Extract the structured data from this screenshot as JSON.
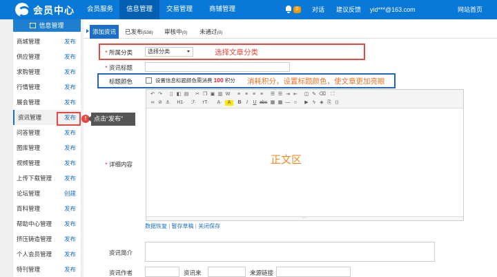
{
  "header": {
    "logo_text": "会员中心",
    "nav": [
      "会员服务",
      "信息管理",
      "交易管理",
      "商铺管理"
    ],
    "notify_count": "0",
    "links": [
      "对话",
      "建议反馈"
    ],
    "user": "yid***@163.com",
    "home_link": "网站首页"
  },
  "sidebar": {
    "title": "信息管理",
    "items": [
      {
        "label": "商城管理",
        "action": "发布"
      },
      {
        "label": "供应管理",
        "action": "发布"
      },
      {
        "label": "求购管理",
        "action": "发布"
      },
      {
        "label": "行情管理",
        "action": "发布"
      },
      {
        "label": "展会管理",
        "action": "发布"
      },
      {
        "label": "资讯管理",
        "action": "发布"
      },
      {
        "label": "问答管理",
        "action": "发布"
      },
      {
        "label": "图库管理",
        "action": "发布"
      },
      {
        "label": "视频管理",
        "action": "发布"
      },
      {
        "label": "上传下载管理",
        "action": "发布"
      },
      {
        "label": "论坛管理",
        "action": "创建"
      },
      {
        "label": "百科管理",
        "action": "发布"
      },
      {
        "label": "帮助中心管理",
        "action": "发布"
      },
      {
        "label": "挤压铸造管理",
        "action": "发布"
      },
      {
        "label": "个人会员管理",
        "action": "发布"
      },
      {
        "label": "特刊管理",
        "action": "发布"
      }
    ]
  },
  "tabs": [
    {
      "label": "添加资讯",
      "count": ""
    },
    {
      "label": "已发布",
      "count": "(538)"
    },
    {
      "label": "审核中",
      "count": "(0)"
    },
    {
      "label": "未通过",
      "count": "(0)"
    }
  ],
  "form": {
    "category_label": "所属分类",
    "category_value": "选择分类",
    "title_label": "资讯标题",
    "color_label": "标题颜色",
    "color_option_text": "设置信息标题颜色需消费",
    "color_cost": "100",
    "color_cost_unit": "积分",
    "detail_label": "详细内容",
    "editor_placeholder": "正文区",
    "editor_links": [
      "数据恢复",
      "暂存草稿",
      "关闭保存"
    ],
    "summary_label": "资讯简介",
    "author_label": "资讯作者",
    "source_label": "资讯来源",
    "source_link_label": "来源链接"
  },
  "annotations": {
    "category_tip": "选择文章分类",
    "color_tip": "消耗积分，设置标题颜色，使文章更加亮眼",
    "callout_badge": "!",
    "callout_text": "点击“发布”"
  },
  "colors": {
    "primary": "#0a78d6",
    "active_nav": "#0560b3",
    "annotation_red": "#e8473f",
    "annotation_blue": "#1f64c7",
    "annotation_orange": "#f08a24"
  }
}
